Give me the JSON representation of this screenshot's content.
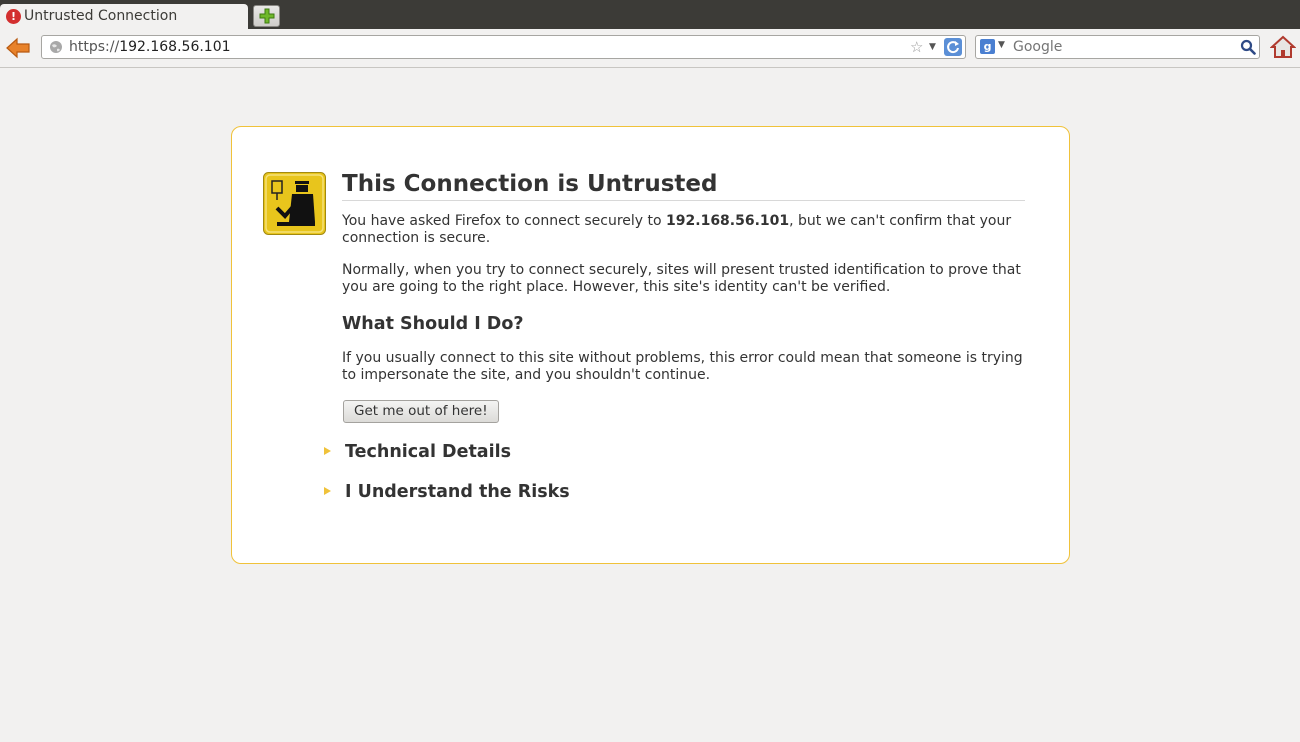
{
  "tab": {
    "title": "Untrusted Connection",
    "icon": "error-icon"
  },
  "urlbar": {
    "scheme": "https://",
    "host": "192.168.56.101"
  },
  "search": {
    "placeholder": "Google",
    "engine_icon": "google-icon"
  },
  "page": {
    "title": "This Connection is Untrusted",
    "p1_before": "You have asked Firefox to connect securely to ",
    "p1_host": "192.168.56.101",
    "p1_after": ", but we can't confirm that your connection is secure.",
    "p2": "Normally, when you try to connect securely, sites will present trusted identification to prove that you are going to the right place. However, this site's identity can't be verified.",
    "subhead": "What Should I Do?",
    "p3": "If you usually connect to this site without problems, this error could mean that someone is trying to impersonate the site, and you shouldn't continue.",
    "button": "Get me out of here!",
    "technical_details": "Technical Details",
    "understand_risks": "I Understand the Risks"
  },
  "colors": {
    "box_border": "#f0c23a",
    "background": "#f2f1f0",
    "titlebar": "#3c3b37"
  }
}
